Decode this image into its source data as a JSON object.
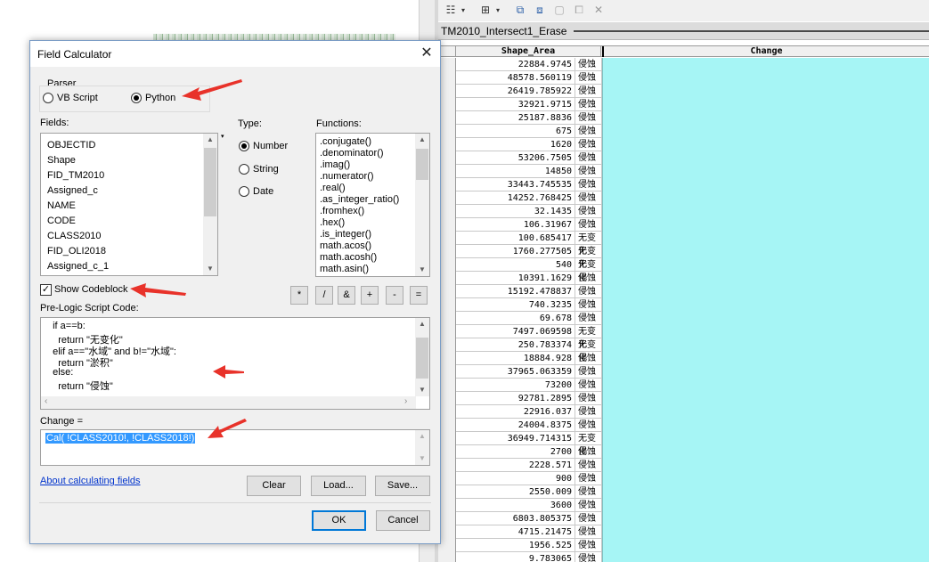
{
  "table": {
    "title": "TM2010_Intersect1_Erase",
    "columns": [
      "Shape_Area",
      "Change"
    ],
    "rows": [
      {
        "area": "22884.9745",
        "change": "侵蚀"
      },
      {
        "area": "48578.560119",
        "change": "侵蚀"
      },
      {
        "area": "26419.785922",
        "change": "侵蚀"
      },
      {
        "area": "32921.9715",
        "change": "侵蚀"
      },
      {
        "area": "25187.8836",
        "change": "侵蚀"
      },
      {
        "area": "675",
        "change": "侵蚀"
      },
      {
        "area": "1620",
        "change": "侵蚀"
      },
      {
        "area": "53206.7505",
        "change": "侵蚀"
      },
      {
        "area": "14850",
        "change": "侵蚀"
      },
      {
        "area": "33443.745535",
        "change": "侵蚀"
      },
      {
        "area": "14252.768425",
        "change": "侵蚀"
      },
      {
        "area": "32.1435",
        "change": "侵蚀"
      },
      {
        "area": "106.31967",
        "change": "侵蚀"
      },
      {
        "area": "100.685417",
        "change": "无变化"
      },
      {
        "area": "1760.277505",
        "change": "无变化"
      },
      {
        "area": "540",
        "change": "无变化"
      },
      {
        "area": "10391.1629",
        "change": "侵蚀"
      },
      {
        "area": "15192.478837",
        "change": "侵蚀"
      },
      {
        "area": "740.3235",
        "change": "侵蚀"
      },
      {
        "area": "69.678",
        "change": "侵蚀"
      },
      {
        "area": "7497.069598",
        "change": "无变化"
      },
      {
        "area": "250.783374",
        "change": "无变化"
      },
      {
        "area": "18884.928",
        "change": "侵蚀"
      },
      {
        "area": "37965.063359",
        "change": "侵蚀"
      },
      {
        "area": "73200",
        "change": "侵蚀"
      },
      {
        "area": "92781.2895",
        "change": "侵蚀"
      },
      {
        "area": "22916.037",
        "change": "侵蚀"
      },
      {
        "area": "24004.8375",
        "change": "侵蚀"
      },
      {
        "area": "36949.714315",
        "change": "无变化"
      },
      {
        "area": "2700",
        "change": "侵蚀"
      },
      {
        "area": "2228.571",
        "change": "侵蚀"
      },
      {
        "area": "900",
        "change": "侵蚀"
      },
      {
        "area": "2550.009",
        "change": "侵蚀"
      },
      {
        "area": "3600",
        "change": "侵蚀"
      },
      {
        "area": "6803.805375",
        "change": "侵蚀"
      },
      {
        "area": "4715.21475",
        "change": "侵蚀"
      },
      {
        "area": "1956.525",
        "change": "侵蚀"
      },
      {
        "area": "9.783065",
        "change": "侵蚀"
      }
    ]
  },
  "dialog": {
    "title": "Field Calculator",
    "parser_label": "Parser",
    "parser_vbscript": "VB Script",
    "parser_python": "Python",
    "parser_selected": "Python",
    "fields_label": "Fields:",
    "fields": [
      "OBJECTID",
      "Shape",
      "FID_TM2010",
      "Assigned_c",
      "NAME",
      "CODE",
      "CLASS2010",
      "FID_OLI2018",
      "Assigned_c_1"
    ],
    "type_label": "Type:",
    "type_number": "Number",
    "type_string": "String",
    "type_date": "Date",
    "type_selected": "Number",
    "functions_label": "Functions:",
    "functions": [
      ".conjugate()",
      ".denominator()",
      ".imag()",
      ".numerator()",
      ".real()",
      ".as_integer_ratio()",
      ".fromhex()",
      ".hex()",
      ".is_integer()",
      "math.acos()",
      "math.acosh()",
      "math.asin()"
    ],
    "show_codeblock_label": "Show Codeblock",
    "show_codeblock_checked": true,
    "operators": [
      "*",
      "/",
      "&",
      "+",
      "-",
      "="
    ],
    "prelogic_label": "Pre-Logic Script Code:",
    "prelogic_lines": [
      "  if a==b:",
      "    return \"无变化\"",
      "  elif a==\"水域\" and b!=\"水域\":",
      "    return \"淤积\"",
      "  else:",
      "    return \"侵蚀\""
    ],
    "expr_label": "Change =",
    "expression": "Cal( !CLASS2010!, !CLASS2018!)",
    "about_link": "About calculating fields",
    "clear_label": "Clear",
    "load_label": "Load...",
    "save_label": "Save...",
    "ok_label": "OK",
    "cancel_label": "Cancel"
  },
  "annotation_color": "#e8322a"
}
